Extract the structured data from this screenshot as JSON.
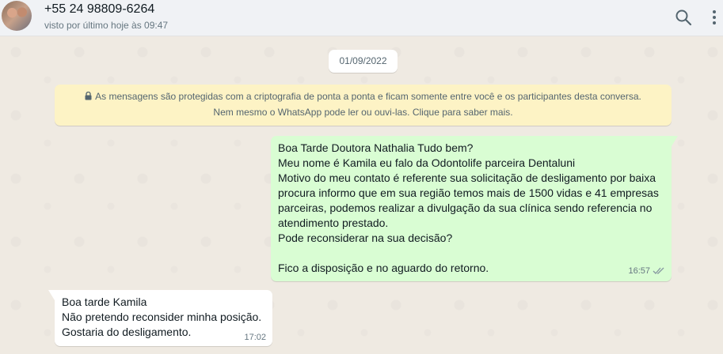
{
  "header": {
    "contact_name": "+55 24 98809-6264",
    "last_seen": "visto por último hoje às 09:47",
    "icons": [
      "search-icon",
      "menu-icon"
    ]
  },
  "chat": {
    "date_chip": "01/09/2022",
    "encryption_notice": {
      "line1": "As mensagens são protegidas com a criptografia de ponta a ponta e ficam somente entre você e os participantes desta conversa.",
      "line2": "Nem mesmo o WhatsApp pode ler ou ouvi-las. Clique para saber mais."
    },
    "messages": [
      {
        "direction": "outgoing",
        "lines": [
          "Boa Tarde Doutora Nathalia Tudo bem?",
          "Meu nome é Kamila eu falo da Odontolife parceira Dentaluni",
          "Motivo do meu contato é referente sua solicitação de desligamento por baixa",
          "procura informo que em sua região temos mais de 1500 vidas e 41 empresas",
          "parceiras, podemos realizar a divulgação da sua clínica sendo referencia no",
          "atendimento prestado.",
          "Pode reconsiderar na sua decisão?",
          "",
          "Fico a disposição e no aguardo do retorno."
        ],
        "time": "16:57",
        "status": "read"
      },
      {
        "direction": "incoming",
        "lines": [
          "Boa tarde Kamila",
          "Não pretendo reconsider minha posição.",
          "Gostaria do desligamento."
        ],
        "time": "17:02"
      }
    ]
  },
  "colors": {
    "header_bg": "#f0f2f5",
    "chat_bg": "#efeae2",
    "outgoing_bubble": "#d9fdd3",
    "incoming_bubble": "#ffffff",
    "system_notice": "#fdf3c5"
  }
}
